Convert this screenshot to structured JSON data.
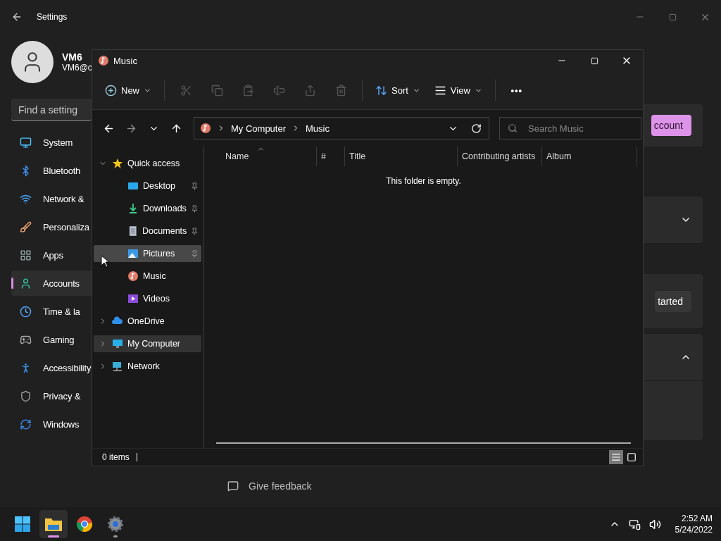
{
  "settings": {
    "title": "Settings",
    "user": {
      "name": "VM6",
      "email": "VM6@c"
    },
    "search": {
      "placeholder": "Find a setting"
    },
    "nav": [
      {
        "label": "System",
        "kind": "system",
        "selected": false
      },
      {
        "label": "Bluetooth",
        "kind": "bluetooth",
        "selected": false
      },
      {
        "label": "Network &",
        "kind": "network",
        "selected": false
      },
      {
        "label": "Personaliza",
        "kind": "personalization",
        "selected": false
      },
      {
        "label": "Apps",
        "kind": "apps",
        "selected": false
      },
      {
        "label": "Accounts",
        "kind": "accounts",
        "selected": true
      },
      {
        "label": "Time & la",
        "kind": "time",
        "selected": false
      },
      {
        "label": "Gaming",
        "kind": "gaming",
        "selected": false
      },
      {
        "label": "Accessibility",
        "kind": "accessibility",
        "selected": false
      },
      {
        "label": "Privacy &",
        "kind": "privacy",
        "selected": false
      },
      {
        "label": "Windows",
        "kind": "update",
        "selected": false
      }
    ],
    "cards": [
      {
        "kind": "button",
        "button": "ccount",
        "primary": true
      },
      {
        "kind": "expander",
        "expanded": false
      },
      {
        "kind": "button",
        "button": "tarted",
        "primary": false
      },
      {
        "kind": "expander",
        "expanded": true
      }
    ],
    "feedback": "Give feedback"
  },
  "explorer": {
    "title": "Music",
    "toolbar": [
      {
        "kind": "new",
        "label": "New",
        "disabled": false
      },
      {
        "kind": "cut",
        "disabled": true
      },
      {
        "kind": "copy",
        "disabled": true
      },
      {
        "kind": "paste",
        "disabled": true
      },
      {
        "kind": "rename",
        "disabled": true
      },
      {
        "kind": "share",
        "disabled": true
      },
      {
        "kind": "delete",
        "disabled": true
      },
      {
        "kind": "sort",
        "label": "Sort",
        "disabled": false
      },
      {
        "kind": "view",
        "label": "View",
        "disabled": false
      },
      {
        "kind": "more",
        "label": "•••",
        "disabled": false
      }
    ],
    "breadcrumb": [
      "My Computer",
      "Music"
    ],
    "search": {
      "placeholder": "Search Music"
    },
    "tree": [
      {
        "label": "Quick access",
        "kind": "star",
        "expanded": true,
        "selected": false,
        "children": [
          {
            "label": "Desktop",
            "kind": "desktop",
            "pinned": true,
            "selected": false,
            "hovered": false
          },
          {
            "label": "Downloads",
            "kind": "downloads",
            "pinned": true,
            "selected": false,
            "hovered": false
          },
          {
            "label": "Documents",
            "kind": "documents",
            "pinned": true,
            "selected": false,
            "hovered": false
          },
          {
            "label": "Pictures",
            "kind": "pictures",
            "pinned": true,
            "selected": false,
            "hovered": true
          },
          {
            "label": "Music",
            "kind": "music",
            "pinned": false,
            "selected": false,
            "hovered": false
          },
          {
            "label": "Videos",
            "kind": "videos",
            "pinned": false,
            "selected": false,
            "hovered": false
          }
        ]
      },
      {
        "label": "OneDrive",
        "kind": "cloud",
        "expanded": false,
        "selected": false
      },
      {
        "label": "My Computer",
        "kind": "computer",
        "expanded": false,
        "selected": true
      },
      {
        "label": "Network",
        "kind": "netpc",
        "expanded": false,
        "selected": false
      }
    ],
    "columns": [
      {
        "label": "Name",
        "sorted": true
      },
      {
        "label": "#",
        "sorted": false
      },
      {
        "label": "Title",
        "sorted": false
      },
      {
        "label": "Contributing artists",
        "sorted": false
      },
      {
        "label": "Album",
        "sorted": false
      }
    ],
    "empty_message": "This folder is empty.",
    "status": "0 items",
    "views": [
      {
        "kind": "details",
        "selected": true
      },
      {
        "kind": "tiles",
        "selected": false
      }
    ]
  },
  "taskbar": {
    "apps": [
      {
        "kind": "start",
        "active": false,
        "running": false
      },
      {
        "kind": "explorer",
        "active": true,
        "running": true
      },
      {
        "kind": "chrome",
        "active": false,
        "running": false
      },
      {
        "kind": "settings",
        "active": false,
        "running": true
      }
    ],
    "time": "2:52 AM",
    "date": "5/24/2022"
  }
}
